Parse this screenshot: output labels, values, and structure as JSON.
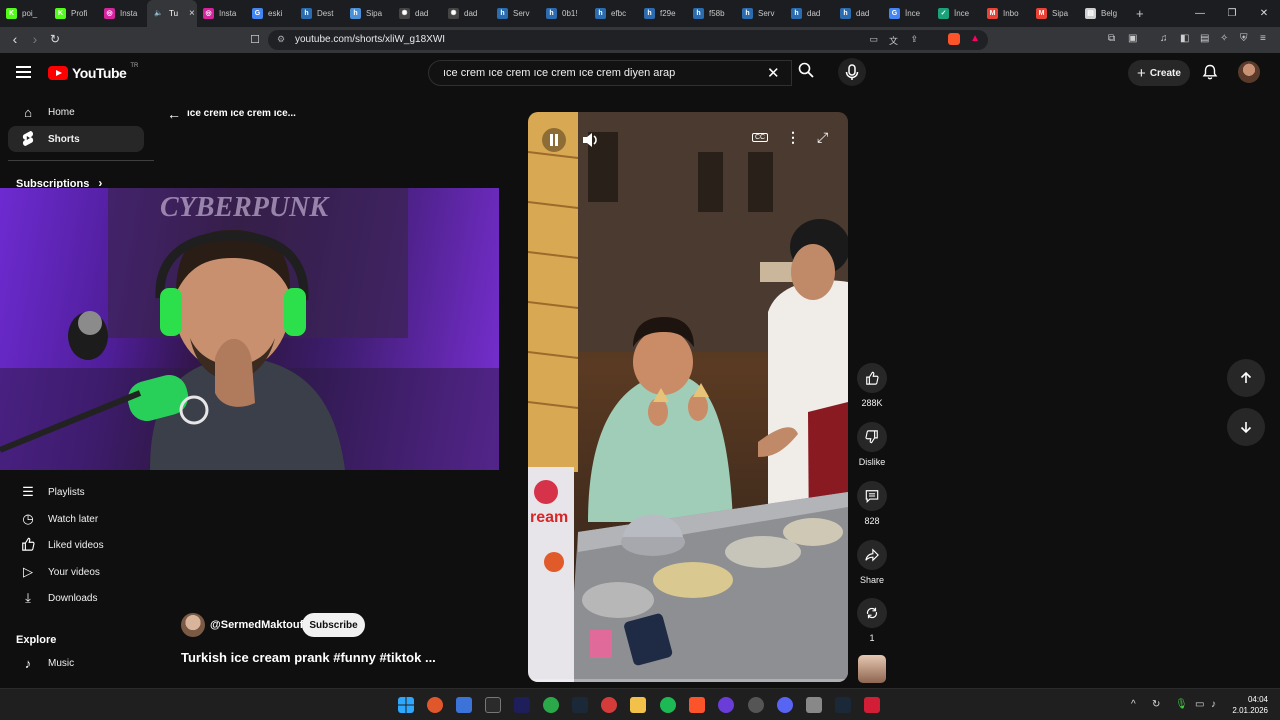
{
  "browser": {
    "tabs": [
      {
        "label": "poi_",
        "icon": "kick-icon",
        "color": "#53fc18"
      },
      {
        "label": "Profi",
        "icon": "kick-icon",
        "color": "#53fc18"
      },
      {
        "label": "Insta",
        "icon": "instagram-icon",
        "color": "#d6249f"
      },
      {
        "label": "Tu",
        "icon": "speaker-icon",
        "color": "#35363a",
        "active": true
      },
      {
        "label": "Insta",
        "icon": "instagram-icon",
        "color": "#d6249f"
      },
      {
        "label": "eski",
        "icon": "google-icon",
        "color": "#4285f4"
      },
      {
        "label": "Dest",
        "icon": "doc-icon",
        "color": "#2b6cb0"
      },
      {
        "label": "Sipa",
        "icon": "doc-icon",
        "color": "#4a90d9"
      },
      {
        "label": "dad",
        "icon": "chatgpt-icon",
        "color": "#444"
      },
      {
        "label": "dad",
        "icon": "chatgpt-icon",
        "color": "#444"
      },
      {
        "label": "Serv",
        "icon": "doc-icon",
        "color": "#2b6cb0"
      },
      {
        "label": "0b1!",
        "icon": "doc-icon",
        "color": "#2b6cb0"
      },
      {
        "label": "efbc",
        "icon": "doc-icon",
        "color": "#2b6cb0"
      },
      {
        "label": "f29e",
        "icon": "doc-icon",
        "color": "#2b6cb0"
      },
      {
        "label": "f58b",
        "icon": "doc-icon",
        "color": "#2b6cb0"
      },
      {
        "label": "Serv",
        "icon": "doc-icon",
        "color": "#2b6cb0"
      },
      {
        "label": "dad",
        "icon": "doc-icon",
        "color": "#2b6cb0"
      },
      {
        "label": "dad",
        "icon": "doc-icon",
        "color": "#2b6cb0"
      },
      {
        "label": "İnce",
        "icon": "google-icon",
        "color": "#4285f4"
      },
      {
        "label": "İnce",
        "icon": "check-icon",
        "color": "#1aa37a"
      },
      {
        "label": "Inbo",
        "icon": "gmail-icon",
        "color": "#ea4335"
      },
      {
        "label": "Sipa",
        "icon": "gmail-icon",
        "color": "#ea4335"
      },
      {
        "label": "Belg",
        "icon": "page-icon",
        "color": "#cfcfcf"
      }
    ],
    "url": "youtube.com/shorts/xliW_g18XWI"
  },
  "header": {
    "logo_text": "YouTube",
    "logo_region": "TR",
    "search_query": "ıce crem ıce crem ıce crem ıce crem diyen arap",
    "create_label": "Create"
  },
  "sidebar": {
    "items": [
      {
        "label": "Home",
        "icon": "home-icon"
      },
      {
        "label": "Shorts",
        "icon": "shorts-icon"
      }
    ],
    "subscriptions_label": "Subscriptions",
    "you_items": [
      {
        "label": "Playlists",
        "icon": "playlists-icon"
      },
      {
        "label": "Watch later",
        "icon": "clock-icon"
      },
      {
        "label": "Liked videos",
        "icon": "thumbs-up-icon"
      },
      {
        "label": "Your videos",
        "icon": "video-icon"
      },
      {
        "label": "Downloads",
        "icon": "download-icon"
      }
    ],
    "explore_label": "Explore",
    "explore_items": [
      {
        "label": "Music",
        "icon": "music-icon"
      }
    ]
  },
  "webcam_overlay": {
    "poster_text": "CYBERPUNK"
  },
  "short": {
    "back_title": "ıce crem ıce crem ıce...",
    "channel": "@SermedMaktouf",
    "subscribe_label": "Subscribe",
    "title": "Turkish ice cream prank #funny  #tiktok ...",
    "video_progress": 0.01,
    "video_scene": {
      "sign_text": "ream"
    }
  },
  "actions": {
    "like_count": "288K",
    "dislike_label": "Dislike",
    "comment_count": "828",
    "share_label": "Share",
    "remix_count": "1"
  },
  "taskbar": {
    "time": "04:04",
    "date": "2.01.2026"
  }
}
